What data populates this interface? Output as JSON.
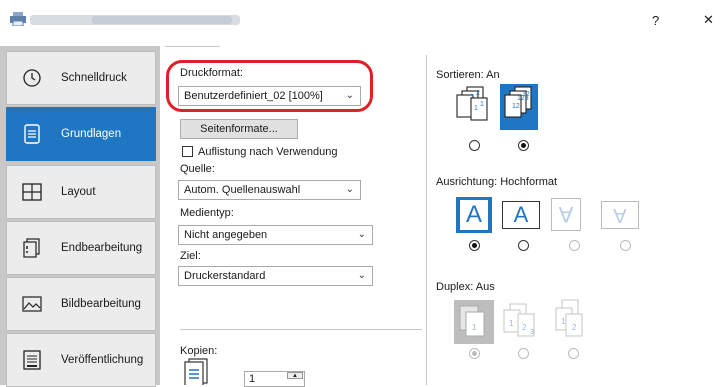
{
  "window": {
    "title_controls": {
      "help": "?",
      "close": "✕"
    }
  },
  "sidebar": {
    "items": [
      {
        "label": "Schnelldruck",
        "icon": "clock-icon"
      },
      {
        "label": "Grundlagen",
        "icon": "document-icon",
        "active": true
      },
      {
        "label": "Layout",
        "icon": "layout-grid-icon"
      },
      {
        "label": "Endbearbeitung",
        "icon": "finishing-icon"
      },
      {
        "label": "Bildbearbeitung",
        "icon": "image-icon"
      },
      {
        "label": "Veröffentlichung",
        "icon": "publication-icon"
      }
    ]
  },
  "basics": {
    "druckformat_label": "Druckformat:",
    "druckformat_value": "Benutzerdefiniert_02 [100%]",
    "seitenformate_button": "Seitenformate...",
    "auflistung_label": "Auflistung nach Verwendung",
    "auflistung_checked": false,
    "quelle_label": "Quelle:",
    "quelle_value": "Autom. Quellenauswahl",
    "medientyp_label": "Medientyp:",
    "medientyp_value": "Nicht angegeben",
    "ziel_label": "Ziel:",
    "ziel_value": "Druckerstandard",
    "kopien_label": "Kopien:",
    "kopien_value": "1"
  },
  "right": {
    "sortieren_label": "Sortieren:",
    "sortieren_value": "An",
    "ausrichtung_label": "Ausrichtung:",
    "ausrichtung_value": "Hochformat",
    "orientation_glyph": "A",
    "duplex_label": "Duplex:",
    "duplex_value": "Aus"
  },
  "colors": {
    "accent": "#1f76c3",
    "highlight": "#e21f26",
    "sidebar_bg": "#c8c8c8"
  }
}
